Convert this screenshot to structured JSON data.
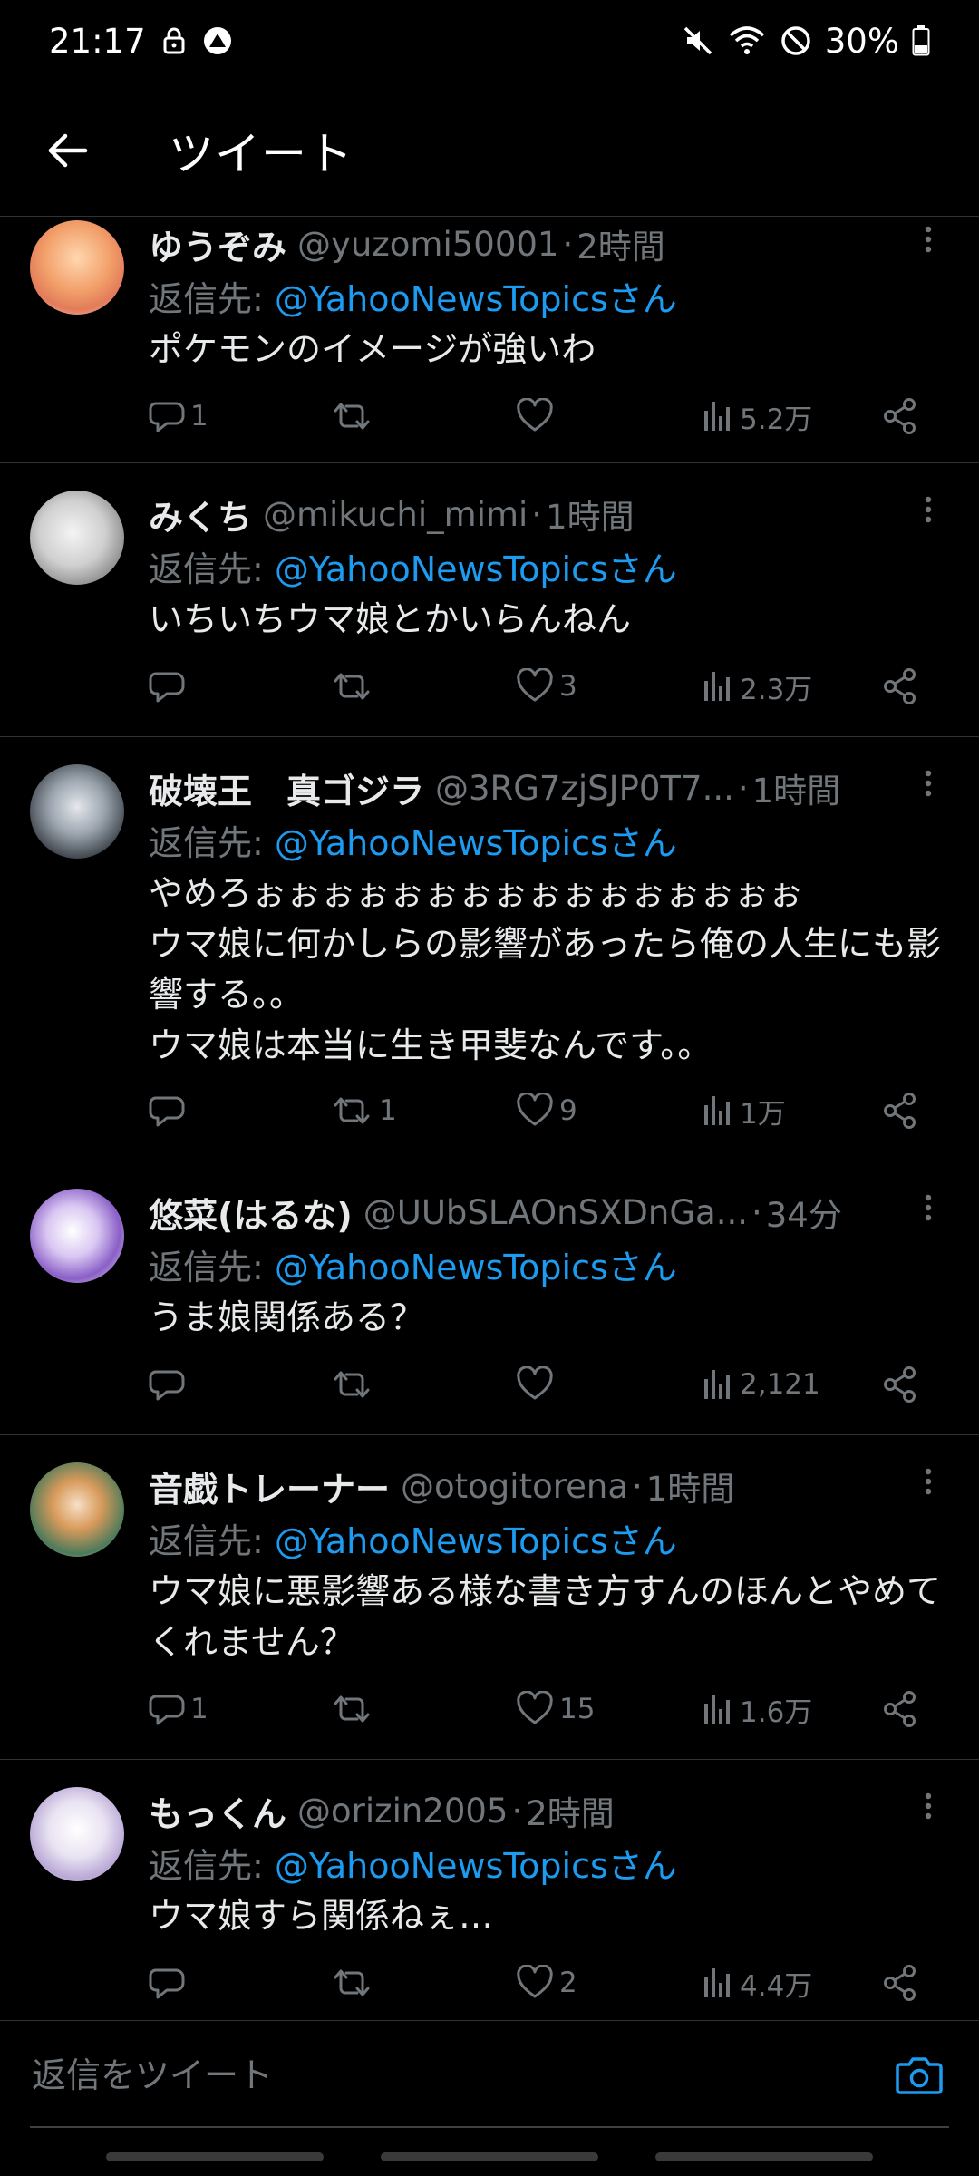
{
  "status_bar": {
    "time": "21:17",
    "battery": "30%",
    "icons": [
      "lock-icon",
      "app-notification-icon",
      "mute-icon",
      "wifi-icon",
      "do-not-disturb-icon",
      "battery-icon"
    ]
  },
  "header": {
    "title": "ツイート"
  },
  "tweets": [
    {
      "name": "ゆうぞみ",
      "handle": "@yuzomi50001",
      "time": "2時間",
      "reply_prefix": "返信先: ",
      "reply_to": "@YahooNewsTopicsさん",
      "text": "ポケモンのイメージが強いわ",
      "replies": "1",
      "retweets": "",
      "likes": "",
      "views": "5.2万"
    },
    {
      "name": "みくち",
      "handle": "@mikuchi_mimi",
      "time": "1時間",
      "reply_prefix": "返信先: ",
      "reply_to": "@YahooNewsTopicsさん",
      "text": "いちいちウマ娘とかいらんねん",
      "replies": "",
      "retweets": "",
      "likes": "3",
      "views": "2.3万"
    },
    {
      "name": "破壊王　真ゴジラ",
      "handle": "@3RG7zjSJP0T7...",
      "time": "1時間",
      "reply_prefix": "返信先: ",
      "reply_to": "@YahooNewsTopicsさん",
      "text": "やめろぉぉぉぉぉぉぉぉぉぉぉぉぉぉぉぉ\nウマ娘に何かしらの影響があったら俺の人生にも影響する。。\nウマ娘は本当に生き甲斐なんです。。",
      "replies": "",
      "retweets": "1",
      "likes": "9",
      "views": "1万"
    },
    {
      "name": "悠菜(はるな)",
      "handle": "@UUbSLAOnSXDnGa...",
      "time": "34分",
      "reply_prefix": "返信先: ",
      "reply_to": "@YahooNewsTopicsさん",
      "text": "うま娘関係ある？",
      "replies": "",
      "retweets": "",
      "likes": "",
      "views": "2,121"
    },
    {
      "name": "音戯トレーナー",
      "handle": "@otogitorena",
      "time": "1時間",
      "reply_prefix": "返信先: ",
      "reply_to": "@YahooNewsTopicsさん",
      "text": "ウマ娘に悪影響ある様な書き方すんのほんとやめてくれません？",
      "replies": "1",
      "retweets": "",
      "likes": "15",
      "views": "1.6万"
    },
    {
      "name": "もっくん",
      "handle": "@orizin2005",
      "time": "2時間",
      "reply_prefix": "返信先: ",
      "reply_to": "@YahooNewsTopicsさん",
      "text": "ウマ娘すら関係ねぇ…",
      "replies": "",
      "retweets": "",
      "likes": "2",
      "views": "4.4万"
    }
  ],
  "reply_bar": {
    "placeholder": "返信をツイート"
  },
  "colors": {
    "background": "#000000",
    "text": "#e7e9ea",
    "secondary": "#71767b",
    "accent": "#1d9bf0",
    "divider": "#2f3336"
  }
}
